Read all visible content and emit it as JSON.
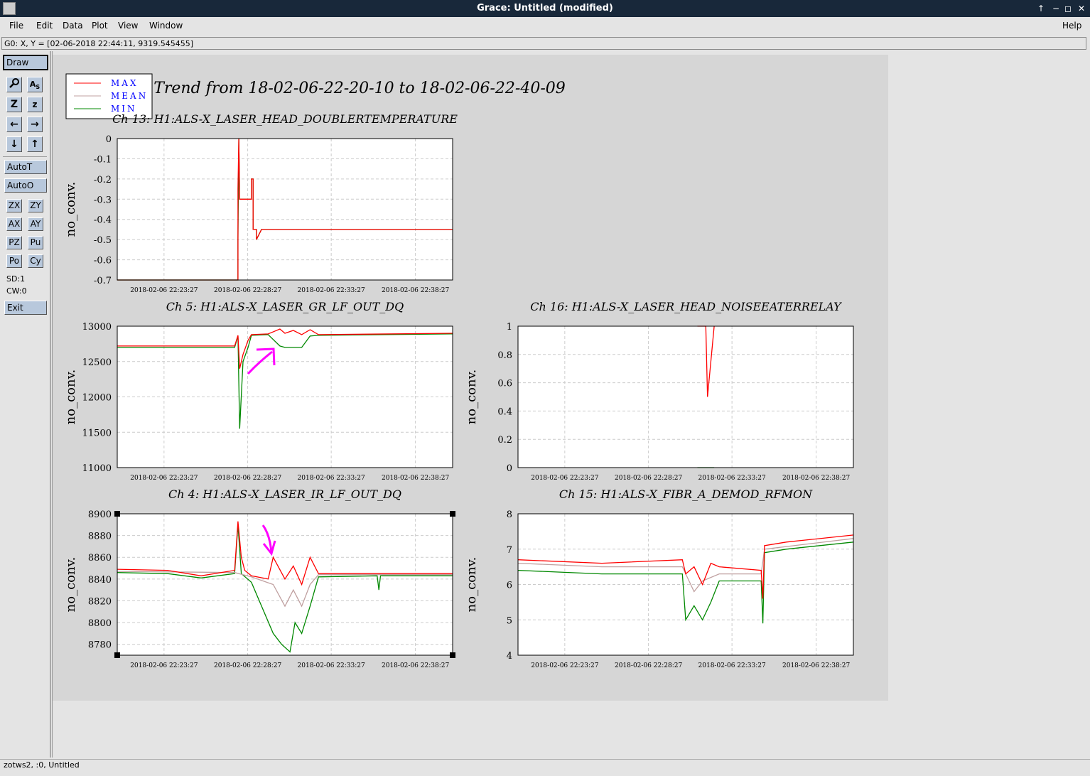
{
  "window": {
    "title": "Grace: Untitled (modified)",
    "controls": [
      "↑",
      "−",
      "◻",
      "✕"
    ]
  },
  "menu": {
    "file": "File",
    "edit": "Edit",
    "data": "Data",
    "plot": "Plot",
    "view": "View",
    "window": "Window",
    "help": "Help"
  },
  "locator": "G0: X, Y = [02-06-2018 22:44:11, 9319.545455]",
  "toolbar": {
    "draw": "Draw",
    "autot": "AutoT",
    "autoo": "AutoO",
    "zx": "ZX",
    "zy": "ZY",
    "ax": "AX",
    "ay": "AY",
    "pz": "PZ",
    "pu": "Pu",
    "po": "Po",
    "cy": "Cy",
    "sd": "SD:1",
    "cw": "CW:0",
    "exit": "Exit",
    "icons": [
      "magnifier-icon",
      "autoscale-icon",
      "zoom-in-icon",
      "zoom-out-icon",
      "left-arrow-icon",
      "right-arrow-icon",
      "down-arrow-icon",
      "up-arrow-icon"
    ]
  },
  "status": "zotws2, :0, Untitled",
  "plot": {
    "main_title": "Trend from 18-02-06-22-20-10 to 18-02-06-22-40-09",
    "legend": [
      "MAX",
      "MEAN",
      "MIN"
    ],
    "colors": {
      "max": "#ff0000",
      "mean": "#c0a0a0",
      "min": "#008800",
      "annotation": "#ff00ff",
      "legend_text": "#0000ff"
    }
  },
  "chart_data": [
    {
      "type": "line",
      "title": "Ch 13: H1:ALS-X_LASER_HEAD_DOUBLERTEMPERATURE",
      "title_visible": "Ch 13: H1:ALS-X_LASER_HEAD_DOUBLERTEMPERATURE",
      "ylabel": "no_conv.",
      "ylim": [
        -0.7,
        0
      ],
      "yticks": [
        "0",
        "-0.1",
        "-0.2",
        "-0.3",
        "-0.4",
        "-0.5",
        "-0.6",
        "-0.7"
      ],
      "xticks": [
        "2018-02-06 22:23:27",
        "2018-02-06 22:28:27",
        "2018-02-06 22:33:27",
        "2018-02-06 22:38:27"
      ],
      "grid": true,
      "series": [
        {
          "name": "MAX",
          "x": [
            0,
            7.2,
            7.2,
            7.25,
            7.3,
            7.5,
            7.5,
            8.0,
            8.0,
            8.1,
            8.1,
            8.3,
            8.3,
            8.6,
            20
          ],
          "values": [
            -0.7,
            -0.7,
            -0.25,
            0,
            -0.3,
            -0.3,
            -0.3,
            -0.3,
            -0.2,
            -0.2,
            -0.45,
            -0.45,
            -0.5,
            -0.45,
            -0.45
          ]
        },
        {
          "name": "MIN",
          "x": [
            0,
            7.2,
            7.2,
            7.25,
            7.3,
            7.5,
            7.5,
            8.0,
            8.0,
            8.1,
            8.1,
            8.3,
            8.3,
            8.6,
            20
          ],
          "values": [
            -0.7,
            -0.7,
            -0.5,
            0,
            -0.3,
            -0.3,
            -0.3,
            -0.3,
            -0.2,
            -0.2,
            -0.45,
            -0.45,
            -0.5,
            -0.45,
            -0.45
          ]
        }
      ]
    },
    {
      "type": "line",
      "title": "Ch 5: H1:ALS-X_LASER_GR_LF_OUT_DQ",
      "ylabel": "no_conv.",
      "ylim": [
        11000,
        13000
      ],
      "yticks": [
        "13000",
        "12500",
        "12000",
        "11500",
        "11000"
      ],
      "xticks": [
        "2018-02-06 22:23:27",
        "2018-02-06 22:28:27",
        "2018-02-06 22:33:27",
        "2018-02-06 22:38:27"
      ],
      "grid": true,
      "series": [
        {
          "name": "MAX",
          "x": [
            0,
            7.0,
            7.2,
            7.3,
            7.5,
            7.8,
            8.0,
            9.0,
            9.7,
            10.0,
            10.5,
            11.0,
            11.5,
            12.0,
            20
          ],
          "values": [
            12720,
            12720,
            12870,
            12400,
            12600,
            12800,
            12880,
            12890,
            12960,
            12900,
            12940,
            12880,
            12950,
            12880,
            12900
          ]
        },
        {
          "name": "MIN",
          "x": [
            0,
            7.0,
            7.2,
            7.3,
            7.5,
            7.8,
            8.0,
            9.0,
            9.7,
            10.0,
            10.5,
            11.0,
            11.5,
            12.0,
            20
          ],
          "values": [
            12700,
            12700,
            12860,
            11550,
            12500,
            12700,
            12870,
            12880,
            12720,
            12700,
            12700,
            12700,
            12860,
            12870,
            12890
          ]
        }
      ],
      "annotation": "magenta arrow"
    },
    {
      "type": "line",
      "title": "Ch 16: H1:ALS-X_LASER_HEAD_NOISEEATERRELAY",
      "ylabel": "no_conv.",
      "ylim": [
        0,
        1
      ],
      "yticks": [
        "1",
        "0.8",
        "0.6",
        "0.4",
        "0.2",
        "0"
      ],
      "xticks": [
        "2018-02-06 22:23:27",
        "2018-02-06 22:28:27",
        "2018-02-06 22:33:27",
        "2018-02-06 22:38:27"
      ],
      "grid": true,
      "series": [
        {
          "name": "MAX",
          "x": [
            10.7,
            10.8,
            11.2,
            11.3,
            11.7
          ],
          "values": [
            1,
            1,
            1,
            0.5,
            1
          ]
        },
        {
          "name": "MIN",
          "x": [
            10.7,
            10.8,
            11.2,
            11.3,
            11.7
          ],
          "values": [
            0,
            0,
            0,
            0,
            0
          ]
        }
      ]
    },
    {
      "type": "line",
      "title": "Ch 4: H1:ALS-X_LASER_IR_LF_OUT_DQ",
      "ylabel": "no_conv.",
      "ylim": [
        8770,
        8900
      ],
      "yticks": [
        "8900",
        "8880",
        "8860",
        "8840",
        "8820",
        "8800",
        "8780"
      ],
      "xticks": [
        "2018-02-06 22:23:27",
        "2018-02-06 22:28:27",
        "2018-02-06 22:33:27",
        "2018-02-06 22:38:27"
      ],
      "grid": true,
      "series": [
        {
          "name": "MAX",
          "x": [
            0,
            3,
            5,
            7,
            7.2,
            7.4,
            7.6,
            8.0,
            9.0,
            9.3,
            10.0,
            10.5,
            11.0,
            11.5,
            12,
            15,
            20
          ],
          "values": [
            8849,
            8848,
            8843,
            8848,
            8893,
            8860,
            8848,
            8843,
            8840,
            8860,
            8840,
            8852,
            8835,
            8860,
            8845,
            8845,
            8845
          ]
        },
        {
          "name": "MEAN",
          "x": [
            0,
            7,
            8,
            9.3,
            10.0,
            10.5,
            11.0,
            11.5,
            12,
            20
          ],
          "values": [
            8847,
            8846,
            8842,
            8835,
            8815,
            8830,
            8815,
            8835,
            8844,
            8844
          ]
        },
        {
          "name": "MIN",
          "x": [
            0,
            3,
            5,
            7,
            7.2,
            7.4,
            8.0,
            9.3,
            9.8,
            10.3,
            10.6,
            11.0,
            11.5,
            12,
            15.5,
            15.6,
            15.7,
            20
          ],
          "values": [
            8846,
            8845,
            8841,
            8845,
            8890,
            8845,
            8837,
            8790,
            8780,
            8773,
            8800,
            8790,
            8815,
            8842,
            8843,
            8830,
            8843,
            8843
          ]
        }
      ],
      "annotation": "magenta arrow"
    },
    {
      "type": "line",
      "title": "Ch 15: H1:ALS-X_FIBR_A_DEMOD_RFMON",
      "ylabel": "no_conv.",
      "ylim": [
        4,
        8
      ],
      "yticks": [
        "8",
        "7",
        "6",
        "5",
        "4"
      ],
      "xticks": [
        "2018-02-06 22:23:27",
        "2018-02-06 22:28:27",
        "2018-02-06 22:33:27",
        "2018-02-06 22:38:27"
      ],
      "grid": true,
      "series": [
        {
          "name": "MAX",
          "x": [
            0,
            5,
            9.8,
            10.0,
            10.5,
            11,
            11.5,
            12,
            14.5,
            14.6,
            14.7,
            16,
            20
          ],
          "values": [
            6.7,
            6.6,
            6.7,
            6.3,
            6.5,
            6.0,
            6.6,
            6.5,
            6.4,
            5.6,
            7.1,
            7.2,
            7.4
          ]
        },
        {
          "name": "MEAN",
          "x": [
            0,
            5,
            9.8,
            10.5,
            11,
            12,
            14.5,
            14.7,
            20
          ],
          "values": [
            6.6,
            6.5,
            6.5,
            5.8,
            6.1,
            6.3,
            6.3,
            7.0,
            7.3
          ]
        },
        {
          "name": "MIN",
          "x": [
            0,
            5,
            9.8,
            10.0,
            10.5,
            11,
            11.5,
            12,
            14.5,
            14.6,
            14.7,
            16,
            20
          ],
          "values": [
            6.4,
            6.3,
            6.3,
            5.0,
            5.4,
            5.0,
            5.5,
            6.1,
            6.1,
            4.9,
            6.9,
            7.0,
            7.2
          ]
        }
      ]
    }
  ]
}
